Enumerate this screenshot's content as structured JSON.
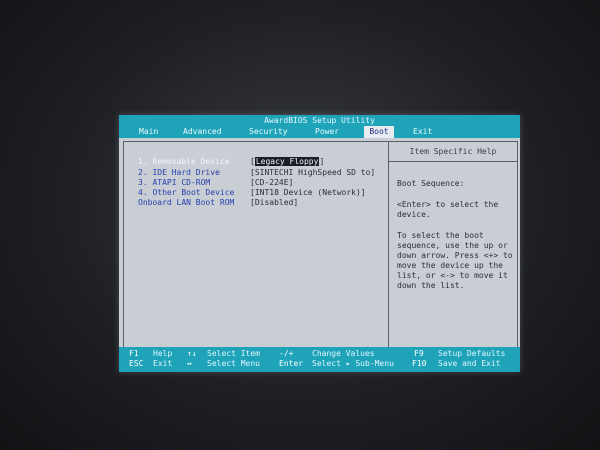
{
  "window_title": "AwardBIOS Setup Utility",
  "menu": [
    {
      "label": "Main"
    },
    {
      "label": "Advanced"
    },
    {
      "label": "Security"
    },
    {
      "label": "Power"
    },
    {
      "label": "Boot",
      "active": true
    },
    {
      "label": "Exit"
    }
  ],
  "boot_items": [
    {
      "label": "1. Removable Device",
      "value": "Legacy Floppy",
      "selected": true
    },
    {
      "label": "2. IDE Hard Drive",
      "value": "[SINTECHI HighSpeed SD to]"
    },
    {
      "label": "3. ATAPI CD-ROM",
      "value": "[CD-224E]"
    },
    {
      "label": "4. Other Boot Device",
      "value": "[INT18 Device (Network)]"
    },
    {
      "label": "Onboard LAN Boot ROM",
      "value": "[Disabled]"
    }
  ],
  "help": {
    "title": "Item Specific Help",
    "heading": "Boot Sequence:",
    "para1": "<Enter> to select the\ndevice.",
    "para2": "To select the boot\nsequence, use the up or\ndown arrow. Press <+> to\nmove the device up the\nlist, or <-> to move it\ndown the list."
  },
  "footer": {
    "f1_key": "F1",
    "f1_desc": "Help",
    "esc_key": "ESC",
    "esc_desc": "Exit",
    "updown_key": "↑↓",
    "updown_desc": "Select Item",
    "leftright_key": "↔",
    "leftright_desc": "Select Menu",
    "pm_key": "-/+",
    "pm_desc": "Change Values",
    "enter_key": "Enter",
    "enter_desc": "Select ▸ Sub-Menu",
    "f9_key": "F9",
    "f9_desc": "Setup Defaults",
    "f10_key": "F10",
    "f10_desc": "Save and Exit"
  },
  "colors": {
    "accent": "#1ea3b8",
    "panel": "#c9cdd4",
    "item_label": "#2842b0"
  }
}
